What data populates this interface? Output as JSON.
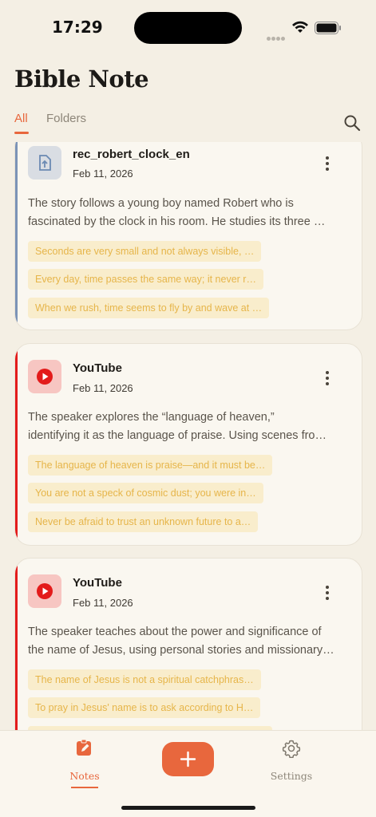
{
  "status_bar": {
    "time": "17:29"
  },
  "header": {
    "title": "Bible Note"
  },
  "tabs": [
    {
      "label": "All",
      "active": true
    },
    {
      "label": "Folders",
      "active": false
    }
  ],
  "colors": {
    "accent": "#e8673d",
    "background": "#f4efe4",
    "card": "#faf7f0",
    "quote_text": "#e6b54a",
    "quote_bg": "#f9edcc",
    "bar_audio": "#7b93b7",
    "bar_youtube": "#e31b1b"
  },
  "notes": [
    {
      "type": "audio",
      "icon": "file-upload-icon",
      "title": "rec_robert_clock_en",
      "date": "Feb 11, 2026",
      "summary": [
        "The story follows a young boy named Robert who is",
        "fascinated by the clock in his room. He studies its three …"
      ],
      "quotes": [
        "Seconds are very small and not always visible, …",
        "Every day, time passes the same way; it never r…",
        "When we rush, time seems to fly by and wave at …"
      ]
    },
    {
      "type": "youtube",
      "icon": "youtube-play-icon",
      "title": "YouTube",
      "date": "Feb 11, 2026",
      "summary": [
        "The speaker explores the “language of heaven,”",
        "identifying it as the language of praise. Using scenes fro…"
      ],
      "quotes": [
        "The language of heaven is praise—and it must be…",
        "You are not a speck of cosmic dust; you were in…",
        "Never be afraid to trust an unknown future to a…"
      ]
    },
    {
      "type": "youtube",
      "icon": "youtube-play-icon",
      "title": "YouTube",
      "date": "Feb 11, 2026",
      "summary": [
        "The speaker teaches about the power and significance of",
        "the name of Jesus, using personal stories and missionary…"
      ],
      "quotes": [
        "The name of Jesus is not a spiritual catchphras…",
        "To pray in Jesus' name is to ask according to H…",
        ""
      ]
    }
  ],
  "bottom_nav": {
    "notes_label": "Notes",
    "settings_label": "Settings",
    "add_label": "+"
  }
}
